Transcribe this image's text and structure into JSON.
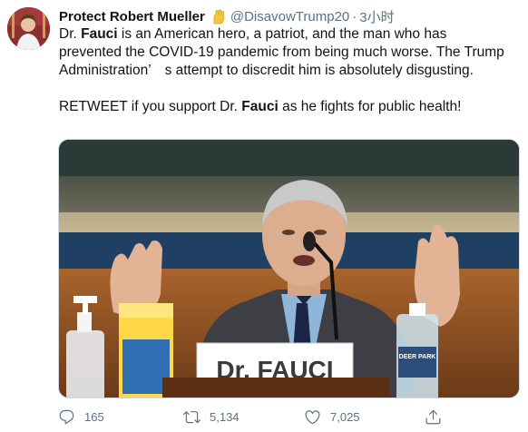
{
  "tweet": {
    "display_name": "Protect Robert Mueller",
    "verified_badge": "raised-fist-emoji",
    "handle": "@DisavowTrump20",
    "separator": "·",
    "timestamp": "3小时",
    "text": {
      "p1_before": "Dr. ",
      "p1_bold": "Fauci",
      "p1_after": " is an American hero, a patriot, and the man who has prevented the COVID-19 pandemic from being much worse. The Trump Administration’　s attempt to discredit him is absolutely disgusting.",
      "p2_before": "RETWEET if you support Dr. ",
      "p2_bold": "Fauci",
      "p2_after": " as he fights for public health!"
    },
    "media": {
      "nameplate": "Dr. FAUCI",
      "bottle_label": "DEER PARK"
    },
    "actions": {
      "reply_count": "165",
      "retweet_count": "5,134",
      "like_count": "7,025"
    },
    "colors": {
      "text": "#0f1419",
      "secondary": "#5b7083",
      "border": "#cfd9de"
    }
  }
}
